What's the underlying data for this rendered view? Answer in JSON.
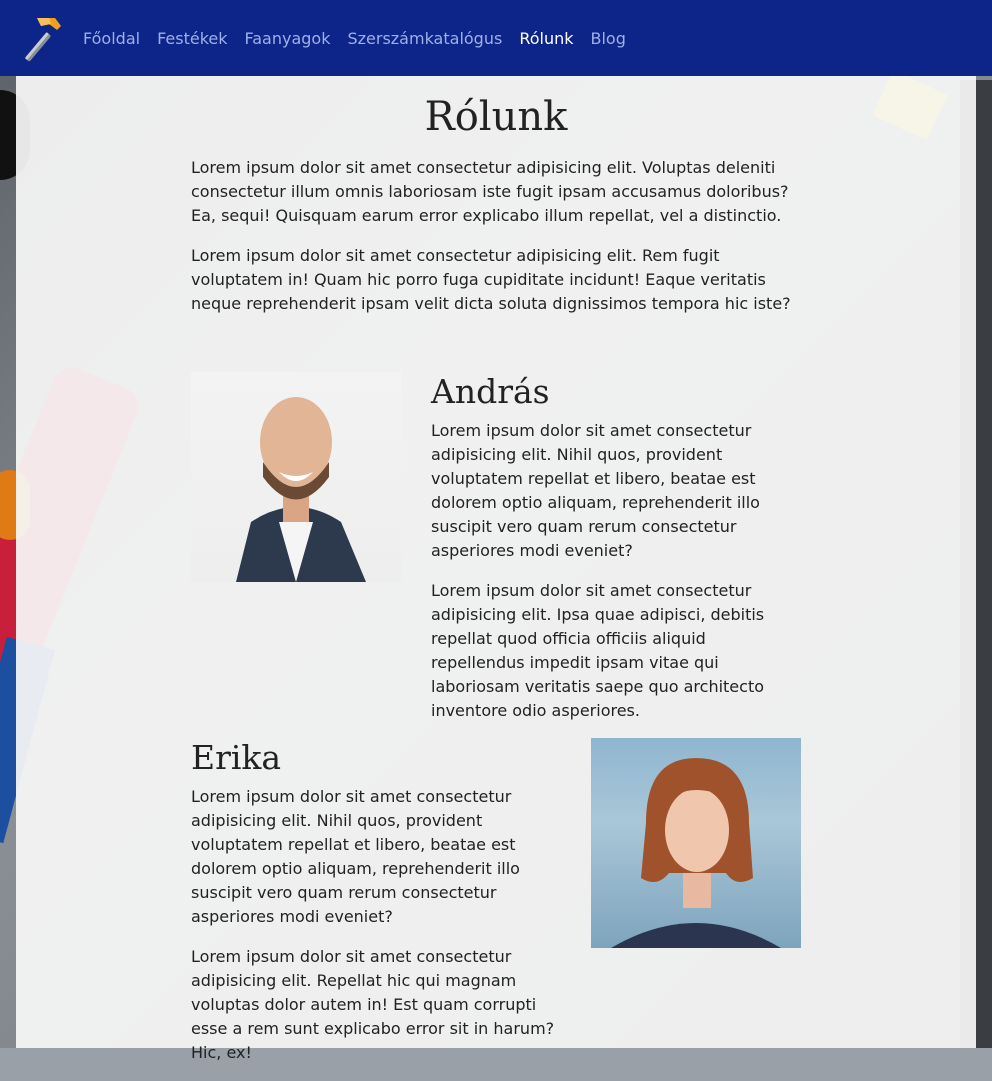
{
  "nav": {
    "logo_icon": "hammer-icon",
    "items": [
      {
        "label": "Főoldal",
        "active": false
      },
      {
        "label": "Festékek",
        "active": false
      },
      {
        "label": "Faanyagok",
        "active": false
      },
      {
        "label": "Szerszámkatalógus",
        "active": false
      },
      {
        "label": "Rólunk",
        "active": true
      },
      {
        "label": "Blog",
        "active": false
      }
    ]
  },
  "about": {
    "title": "Rólunk",
    "paragraphs": [
      "Lorem ipsum dolor sit amet consectetur adipisicing elit. Voluptas deleniti consectetur illum omnis laboriosam iste fugit ipsam accusamus doloribus? Ea, sequi! Quisquam earum error explicabo illum repellat, vel a distinctio.",
      "Lorem ipsum dolor sit amet consectetur adipisicing elit. Rem fugit voluptatem in! Quam hic porro fuga cupiditate incidunt! Eaque veritatis neque reprehenderit ipsam velit dicta soluta dignissimos tempora hic iste?"
    ]
  },
  "members": [
    {
      "name": "András",
      "paragraphs": [
        "Lorem ipsum dolor sit amet consectetur adipisicing elit. Nihil quos, provident voluptatem repellat et libero, beatae est dolorem optio aliquam, reprehenderit illo suscipit vero quam rerum consectetur asperiores modi eveniet?",
        "Lorem ipsum dolor sit amet consectetur adipisicing elit. Ipsa quae adipisci, debitis repellat quod officia officiis aliquid repellendus impedit ipsam vitae qui laboriosam veritatis saepe quo architecto inventore odio asperiores."
      ]
    },
    {
      "name": "Erika",
      "paragraphs": [
        "Lorem ipsum dolor sit amet consectetur adipisicing elit. Nihil quos, provident voluptatem repellat et libero, beatae est dolorem optio aliquam, reprehenderit illo suscipit vero quam rerum consectetur asperiores modi eveniet?",
        "Lorem ipsum dolor sit amet consectetur adipisicing elit. Repellat hic qui magnam voluptas dolor autem in! Est quam corrupti esse a rem sunt explicabo error sit in harum? Hic, ex!"
      ]
    }
  ],
  "colors": {
    "navbar": "#0d2488",
    "nav_link": "#9fb0e8",
    "nav_active": "#ffffff"
  }
}
